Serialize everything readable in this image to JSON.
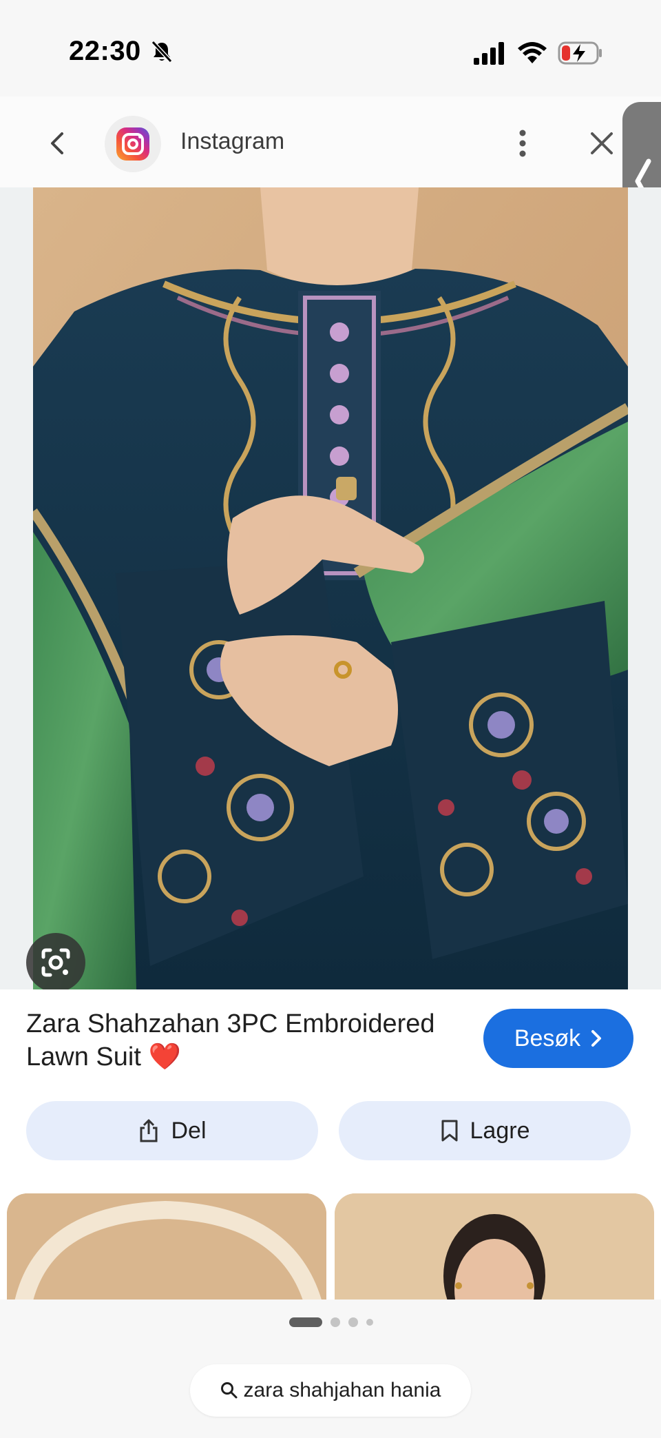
{
  "status_bar": {
    "time": "22:30",
    "icons": [
      "bell-muted-icon",
      "cellular-signal-icon",
      "wifi-icon",
      "battery-charging-icon"
    ]
  },
  "header": {
    "source_name": "Instagram",
    "icons": [
      "back-icon",
      "instagram-logo",
      "more-vert-icon",
      "close-icon",
      "side-panel-chevron-icon"
    ]
  },
  "image": {
    "lens_icon": "google-lens-icon"
  },
  "details": {
    "title": "Zara Shahzahan 3PC Embroidered Lawn Suit ❤️",
    "visit_label": "Besøk",
    "share_label": "Del",
    "save_label": "Lagre"
  },
  "bottom": {
    "pages": 4,
    "active_page": 1,
    "search_query": "zara shahjahan hania"
  },
  "colors": {
    "accent": "#1b6fe0",
    "chip_bg": "#e6edfb",
    "fabric_navy": "#17344a",
    "dupatta_green": "#4f9a5e",
    "background_beige": "#d9b48d"
  }
}
